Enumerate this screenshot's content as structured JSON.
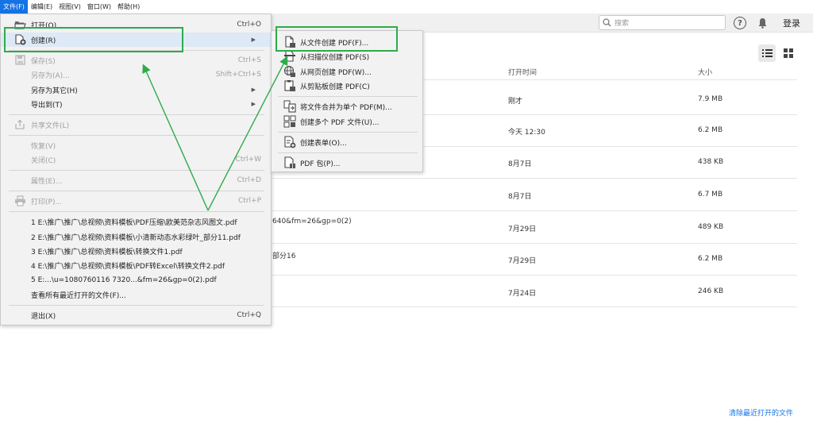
{
  "menubar": [
    {
      "label": "文件(F)",
      "active": true
    },
    {
      "label": "编辑(E)"
    },
    {
      "label": "视图(V)"
    },
    {
      "label": "窗口(W)"
    },
    {
      "label": "帮助(H)"
    }
  ],
  "toolbar": {
    "search_placeholder": "搜索",
    "help_glyph": "?",
    "login_label": "登录"
  },
  "table": {
    "columns": {
      "opened": "打开时间",
      "size": "大小"
    },
    "rows": [
      {
        "name_fragment": "",
        "opened": "刚才",
        "size": "7.9 MB"
      },
      {
        "name_fragment": "",
        "opened": "今天 12:30",
        "size": "6.2 MB"
      },
      {
        "name_fragment": "",
        "opened": "8月7日",
        "size": "438 KB"
      },
      {
        "name_fragment": "",
        "opened": "8月7日",
        "size": "6.7 MB"
      },
      {
        "name_fragment": "640&fm=26&gp=0(2)",
        "opened": "7月29日",
        "size": "489 KB"
      },
      {
        "name_fragment": "部分16",
        "opened": "7月29日",
        "size": "6.2 MB"
      },
      {
        "name_fragment": "",
        "opened": "7月24日",
        "size": "246 KB"
      }
    ],
    "clear_recent": "清除最近打开的文件"
  },
  "file_menu": {
    "open": {
      "label": "打开(O)...",
      "shortcut": "Ctrl+O"
    },
    "create": {
      "label": "创建(R)",
      "arrow": "▶"
    },
    "save": {
      "label": "保存(S)",
      "shortcut": "Ctrl+S"
    },
    "save_as": {
      "label": "另存为(A)...",
      "shortcut": "Shift+Ctrl+S"
    },
    "save_as_other": {
      "label": "另存为其它(H)",
      "arrow": "▶"
    },
    "export_to": {
      "label": "导出到(T)",
      "arrow": "▶"
    },
    "share": {
      "label": "共享文件(L)"
    },
    "revert": {
      "label": "恢复(V)"
    },
    "close": {
      "label": "关闭(C)",
      "shortcut": "Ctrl+W"
    },
    "properties": {
      "label": "属性(E)...",
      "shortcut": "Ctrl+D"
    },
    "print": {
      "label": "打印(P)...",
      "shortcut": "Ctrl+P"
    },
    "recent": [
      "1 E:\\推广\\推广\\总视频\\资料模板\\PDF压缩\\欧美范杂志风图文.pdf",
      "2 E:\\推广\\推广\\总视频\\资料模板\\小清新动态水彩绿叶_部分11.pdf",
      "3 E:\\推广\\推广\\总视频\\资料模板\\转换文件1.pdf",
      "4 E:\\推广\\推广\\总视频\\资料模板\\PDF转Excel\\转换文件2.pdf",
      "5 E:...\\u=1080760116 7320...&fm=26&gp=0(2).pdf"
    ],
    "view_all_recent": "查看所有最近打开的文件(F)...",
    "exit": {
      "label": "退出(X)",
      "shortcut": "Ctrl+Q"
    }
  },
  "create_submenu": {
    "from_file": "从文件创建 PDF(F)...",
    "from_scanner": "从扫描仪创建 PDF(S)",
    "from_web": "从网页创建 PDF(W)...",
    "from_clipboard": "从剪贴板创建 PDF(C)",
    "combine": "将文件合并为单个 PDF(M)...",
    "multiple": "创建多个 PDF 文件(U)...",
    "form": "创建表单(O)...",
    "package": "PDF 包(P)..."
  },
  "annotation_color": "#2eab4b",
  "accent_color": "#1473e6"
}
